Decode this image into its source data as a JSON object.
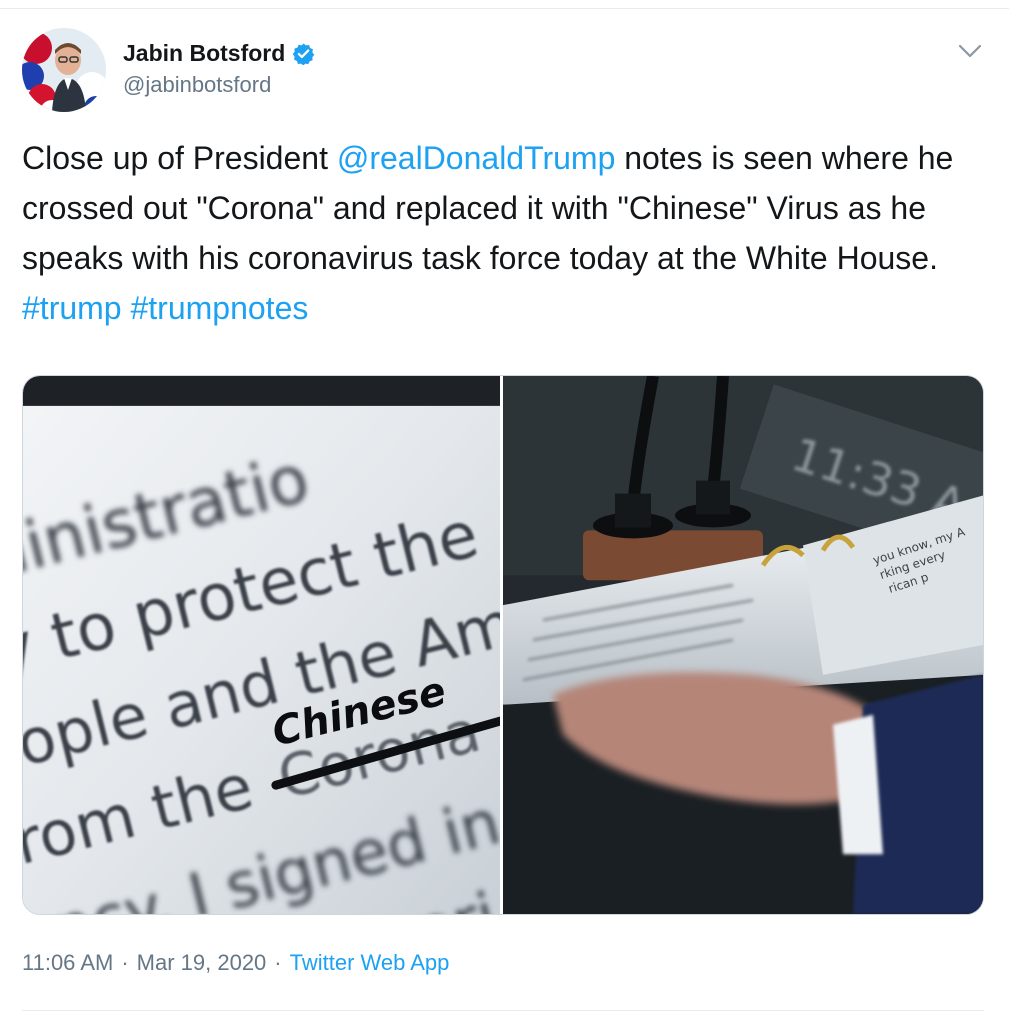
{
  "user": {
    "display_name": "Jabin Botsford",
    "handle": "@jabinbotsford",
    "verified": true
  },
  "tweet": {
    "text_parts": [
      {
        "text": "Close up of President ",
        "link": false
      },
      {
        "text": "@realDonaldTrump",
        "link": true
      },
      {
        "text": " notes is seen where he crossed out \"Corona\" and replaced it with \"Chinese\" Virus as he speaks with his coronavirus task force today at the White House. ",
        "link": false
      },
      {
        "text": "#trump",
        "link": true
      },
      {
        "text": " ",
        "link": false
      },
      {
        "text": "#trumpnotes",
        "link": true
      }
    ],
    "time": "11:06 AM",
    "date": "Mar 19, 2020",
    "separator": "·",
    "source_app": "Twitter Web App"
  },
  "media": {
    "left_photo_text": [
      "ministratio",
      "ay to protect the",
      "eople and the Am",
      "from the",
      "Corona",
      "Chinese",
      "ency. I signed in",
      "help for Ameri"
    ],
    "right_photo_text": {
      "clock": "11:33 A",
      "page_lines": [
        "you know, my A",
        "rking every",
        "rican p"
      ]
    }
  },
  "icons": {
    "verified": "verified-badge-icon",
    "menu": "chevron-down-icon"
  },
  "colors": {
    "link": "#1da1f2",
    "text": "#14171a",
    "secondary": "#657786",
    "border": "#ccd6dd"
  }
}
